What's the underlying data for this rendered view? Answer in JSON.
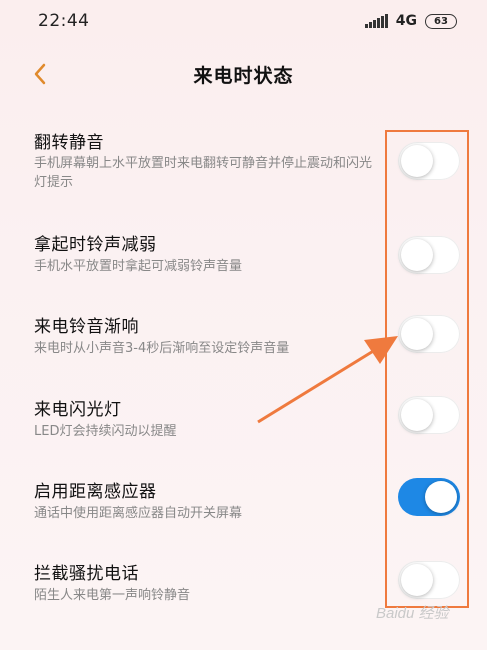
{
  "status_bar": {
    "time": "22:44",
    "network": "4G",
    "battery": "63"
  },
  "header": {
    "title": "来电时状态",
    "back_icon": "chevron-left-icon"
  },
  "settings": [
    {
      "label": "翻转静音",
      "desc": "手机屏幕朝上水平放置时来电翻转可静音并停止震动和闪光灯提示",
      "enabled": false
    },
    {
      "label": "拿起时铃声减弱",
      "desc": "手机水平放置时拿起可减弱铃声音量",
      "enabled": false
    },
    {
      "label": "来电铃音渐响",
      "desc": "来电时从小声音3-4秒后渐响至设定铃声音量",
      "enabled": false
    },
    {
      "label": "来电闪光灯",
      "desc": "LED灯会持续闪动以提醒",
      "enabled": false
    },
    {
      "label": "启用距离感应器",
      "desc": "通话中使用距离感应器自动开关屏幕",
      "enabled": true
    },
    {
      "label": "拦截骚扰电话",
      "desc": "陌生人来电第一声响铃静音",
      "enabled": false
    }
  ],
  "watermark": "Baidu 经验",
  "colors": {
    "accent": "#1e88e5",
    "highlight": "#ef7a3e"
  }
}
